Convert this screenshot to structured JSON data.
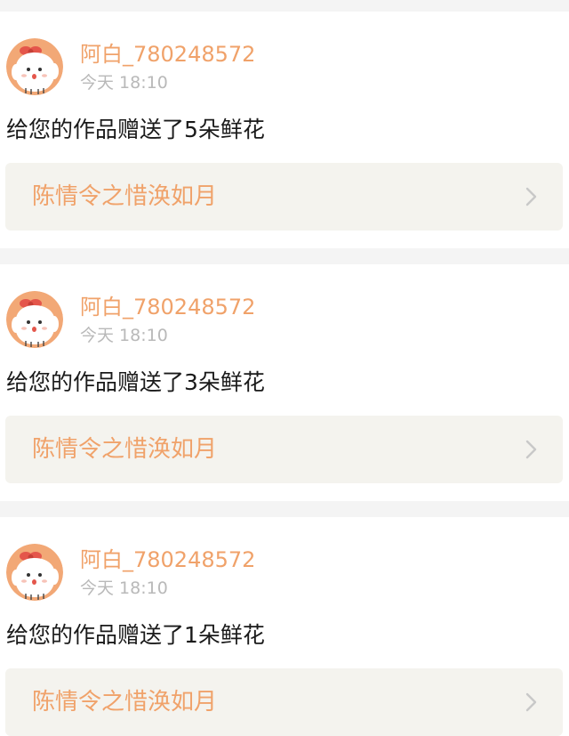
{
  "notifications": [
    {
      "username": "阿白_780248572",
      "time": "今天 18:10",
      "message": "给您的作品赠送了5朵鲜花",
      "work_title": "陈情令之惜涣如月",
      "avatar_icon": "cartoon-bunny-avatar",
      "arrow_icon": "chevron-right-icon"
    },
    {
      "username": "阿白_780248572",
      "time": "今天 18:10",
      "message": "给您的作品赠送了3朵鲜花",
      "work_title": "陈情令之惜涣如月",
      "avatar_icon": "cartoon-bunny-avatar",
      "arrow_icon": "chevron-right-icon"
    },
    {
      "username": "阿白_780248572",
      "time": "今天 18:10",
      "message": "给您的作品赠送了1朵鲜花",
      "work_title": "陈情令之惜涣如月",
      "avatar_icon": "cartoon-bunny-avatar",
      "arrow_icon": "chevron-right-icon"
    }
  ],
  "colors": {
    "accent": "#f0a26a",
    "page_background": "#f4f4f4",
    "card_background": "#ffffff",
    "link_box_background": "#f4f3ee",
    "time_text": "#b9b9b9",
    "message_text": "#1a1a1a",
    "chevron": "#c8c8c8"
  }
}
